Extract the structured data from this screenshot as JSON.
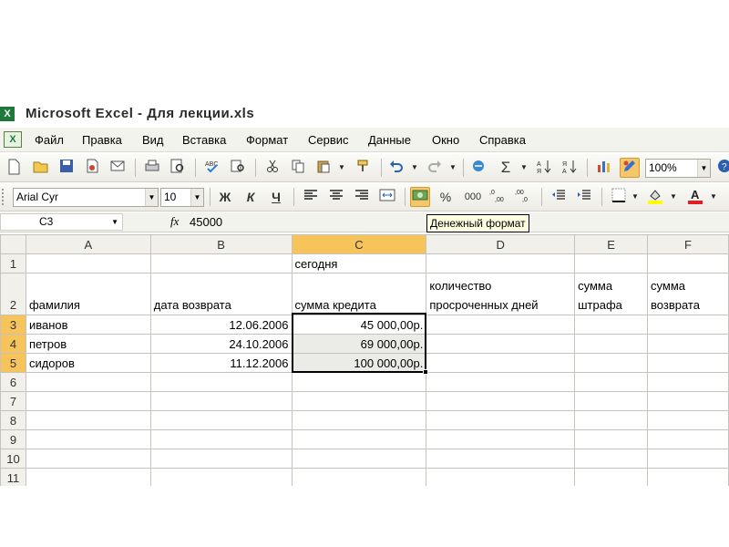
{
  "window": {
    "title": "Microsoft Excel - Для лекции.xls"
  },
  "menu": [
    "Файл",
    "Правка",
    "Вид",
    "Вставка",
    "Формат",
    "Сервис",
    "Данные",
    "Окно",
    "Справка"
  ],
  "standard_toolbar": {
    "zoom": "100%"
  },
  "format_toolbar": {
    "font": "Arial Cyr",
    "size": "10",
    "bold": "Ж",
    "italic": "К",
    "underline": "Ч",
    "percent": "%",
    "thousands": "000"
  },
  "formula_bar": {
    "cell_ref": "C3",
    "fx": "fx",
    "value": "45000"
  },
  "tooltip": "Денежный формат",
  "sheet": {
    "columns": [
      "A",
      "B",
      "C",
      "D",
      "E",
      "F"
    ],
    "rows": [
      "1",
      "2",
      "3",
      "4",
      "5",
      "6",
      "7",
      "8",
      "9",
      "10",
      "11"
    ],
    "cells": {
      "C1": "сегодня",
      "A2": "фамилия",
      "B2": "дата возврата",
      "C2": "сумма кредита",
      "D2": "количество просроченных дней",
      "E2": "сумма штрафа",
      "F2": "сумма возврата",
      "A3": "иванов",
      "B3": "12.06.2006",
      "C3": "45 000,00р.",
      "A4": "петров",
      "B4": "24.10.2006",
      "C4": "69 000,00р.",
      "A5": "сидоров",
      "B5": "11.12.2006",
      "C5": "100 000,00р."
    }
  }
}
